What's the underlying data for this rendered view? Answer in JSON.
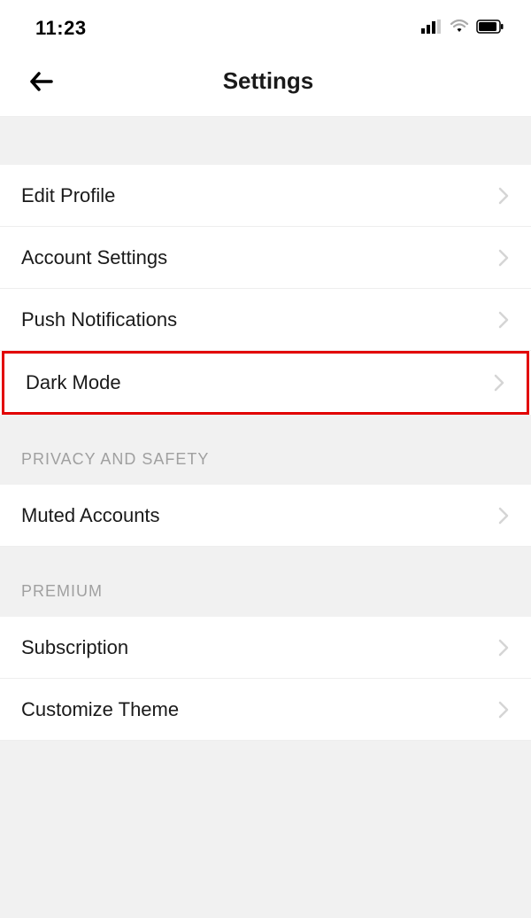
{
  "status": {
    "time": "11:23"
  },
  "header": {
    "title": "Settings"
  },
  "sections": {
    "general": {
      "edit_profile": "Edit Profile",
      "account_settings": "Account Settings",
      "push_notifications": "Push Notifications",
      "dark_mode": "Dark Mode"
    },
    "privacy_header": "PRIVACY AND SAFETY",
    "privacy": {
      "muted_accounts": "Muted Accounts"
    },
    "premium_header": "PREMIUM",
    "premium": {
      "subscription": "Subscription",
      "customize_theme": "Customize Theme"
    }
  }
}
